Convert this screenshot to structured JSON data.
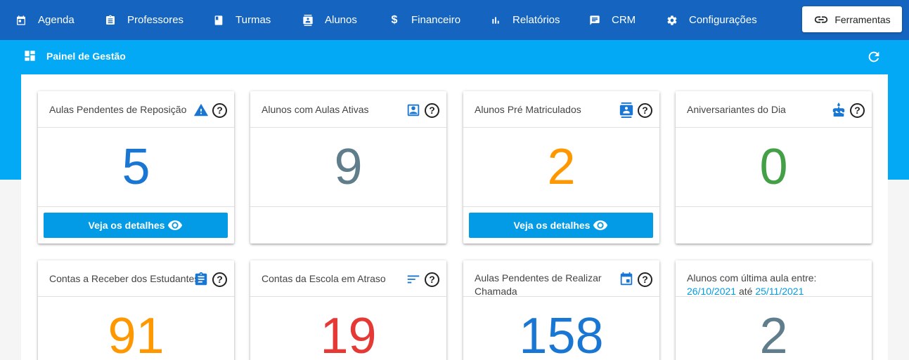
{
  "nav": {
    "items": [
      {
        "label": "Agenda",
        "icon": "calendar-icon"
      },
      {
        "label": "Professores",
        "icon": "badge-icon"
      },
      {
        "label": "Turmas",
        "icon": "book-icon"
      },
      {
        "label": "Alunos",
        "icon": "contacts-icon"
      },
      {
        "label": "Financeiro",
        "icon": "dollar-icon"
      },
      {
        "label": "Relatórios",
        "icon": "bar-chart-icon"
      },
      {
        "label": "CRM",
        "icon": "chat-icon"
      },
      {
        "label": "Configurações",
        "icon": "gear-icon"
      }
    ],
    "tools_label": "Ferramentas"
  },
  "panel": {
    "title": "Painel de Gestão"
  },
  "cards": [
    {
      "title": "Aulas Pendentes de Reposição",
      "value": "5",
      "color": "#1976d2",
      "icon": "warning-icon",
      "button": "Veja os detalhes"
    },
    {
      "title": "Alunos com Aulas Ativas",
      "value": "9",
      "color": "#607d8b",
      "icon": "person-box-icon"
    },
    {
      "title": "Alunos Pré Matriculados",
      "value": "2",
      "color": "#ff9800",
      "icon": "contact-card-icon",
      "button": "Veja os detalhes"
    },
    {
      "title": "Aniversariantes do Dia",
      "value": "0",
      "color": "#43a047",
      "icon": "cake-icon"
    },
    {
      "title": "Contas a Receber dos Estudantes",
      "value": "91",
      "color": "#ff9800",
      "icon": "clipboard-icon"
    },
    {
      "title": "Contas da Escola em Atraso",
      "value": "19",
      "color": "#e53935",
      "icon": "sort-icon"
    },
    {
      "title": "Aulas Pendentes de Realizar Chamada",
      "value": "158",
      "color": "#1976d2",
      "icon": "event-icon"
    },
    {
      "title": "Alunos com última aula entre:",
      "date_from": "26/10/2021",
      "sep": "até",
      "date_to": "25/11/2021",
      "value": "2",
      "color": "#607d8b"
    }
  ]
}
